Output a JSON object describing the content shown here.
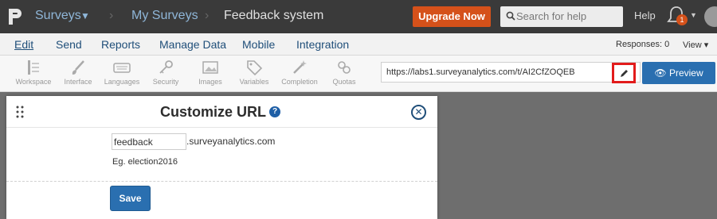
{
  "topbar": {
    "surveys": "Surveys",
    "breadcrumb_sep": "›",
    "my_surveys": "My Surveys",
    "current": "Feedback system",
    "upgrade": "Upgrade Now",
    "search_placeholder": "Search for help",
    "help": "Help",
    "notification_count": "1"
  },
  "menu": {
    "items": [
      "Edit",
      "Send",
      "Reports",
      "Manage Data",
      "Mobile",
      "Integration"
    ],
    "responses": "Responses: 0",
    "view": "View ▾"
  },
  "toolbar": {
    "items": [
      "Workspace",
      "Interface",
      "Languages",
      "Security",
      "Images",
      "Variables",
      "Completion",
      "Quotas"
    ],
    "url": "https://labs1.surveyanalytics.com/t/AI2CfZOQEB",
    "preview": "Preview"
  },
  "modal": {
    "title": "Customize URL",
    "domain_value": "feedback",
    "domain_suffix": ".surveyanalytics.com",
    "example": "Eg. election2016",
    "save": "Save"
  },
  "colors": {
    "topbar_bg": "#3a3a3a",
    "upgrade": "#d5511a",
    "primary": "#2a6fb0",
    "highlight": "#e21b1b"
  }
}
